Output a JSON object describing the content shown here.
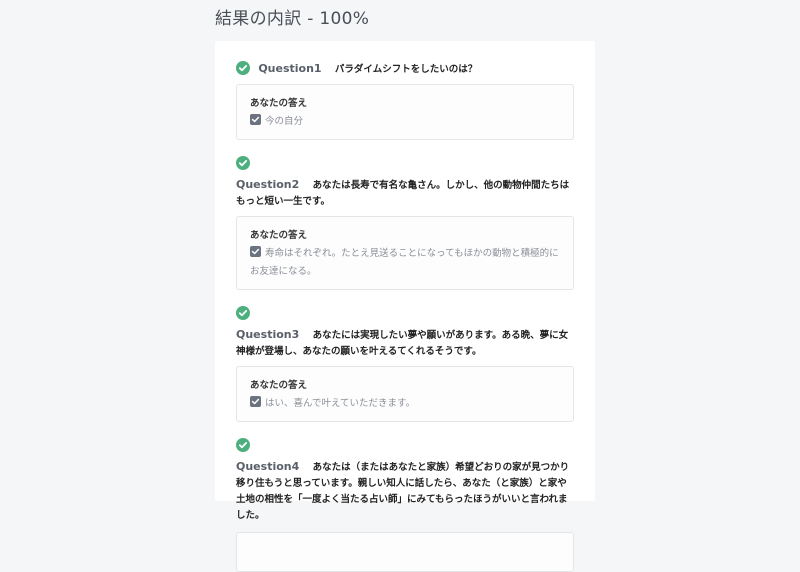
{
  "page": {
    "title": "結果の内訳 - 100%"
  },
  "answer_heading": "あなたの答え",
  "questions": [
    {
      "label": "Question1",
      "text": "パラダイムシフトをしたいのは？",
      "answer": "今の自分"
    },
    {
      "label": "Question2",
      "text": "あなたは長寿で有名な亀さん。しかし、他の動物仲間たちはもっと短い一生です。",
      "answer": "寿命はそれぞれ。たとえ見送ることになってもほかの動物と積極的にお友達になる。"
    },
    {
      "label": "Question3",
      "text": "あなたには実現したい夢や願いがあります。ある晩、夢に女神様が登場し、あなたの願いを叶えるてくれるそうです。",
      "answer": "はい、喜んで叶えていただきます。"
    },
    {
      "label": "Question4",
      "text": "あなたは（またはあなたと家族）希望どおりの家が見つかり移り住もうと思っています。親しい知人に話したら、あなた（と家族）と家や土地の相性を「一度よく当たる占い師」にみてもらったほうがいいと言われました。"
    }
  ],
  "colors": {
    "check": "#4caf7d",
    "checkbox": "#6b7280"
  },
  "icons": {
    "correct": "check-circle-icon",
    "checked": "checkbox-checked-icon"
  }
}
